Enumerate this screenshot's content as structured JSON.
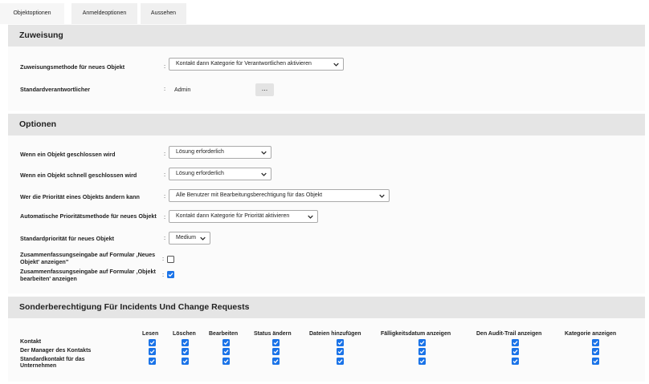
{
  "tabs": [
    {
      "label": "Objektoptionen",
      "active": true
    },
    {
      "label": "Anmeldeoptionen",
      "active": false
    },
    {
      "label": "Aussehen",
      "active": false
    }
  ],
  "sections": {
    "assignment": {
      "title": "Zuweisung",
      "method_label": "Zuweisungsmethode für neues Objekt",
      "method_value": "Kontakt dann Kategorie für Verantwortlichen aktivieren",
      "default_owner_label": "Standardverantwortlicher",
      "default_owner_value": "Admin",
      "browse_label": "..."
    },
    "options": {
      "title": "Optionen",
      "closed_label": "Wenn ein Objekt geschlossen wird",
      "closed_value": "Lösung erforderlich",
      "quick_closed_label": "Wenn ein Objekt schnell geschlossen wird",
      "quick_closed_value": "Lösung erforderlich",
      "priority_change_label": "Wer die Priorität eines Objekts ändern kann",
      "priority_change_value": "Alle Benutzer mit Bearbeitungsberechtigung für das Objekt",
      "auto_priority_label": "Automatische Prioritätsmethode für neues Objekt",
      "auto_priority_value": "Kontakt dann Kategorie für Priorität aktivieren",
      "default_priority_label": "Standardpriorität für neues Objekt",
      "default_priority_value": "Medium",
      "summary_new_label": "Zusammenfassungseingabe auf Formular ‚Neues Objekt' anzeigen\"",
      "summary_new_checked": false,
      "summary_edit_label": "Zusammenfassungseingabe auf Formular ‚Objekt bearbeiten' anzeigen",
      "summary_edit_checked": true
    },
    "permissions": {
      "title": "Sonderberechtigung Für Incidents Und Change Requests",
      "columns": [
        "Lesen",
        "Löschen",
        "Bearbeiten",
        "Status ändern",
        "Dateien hinzufügen",
        "Fälligkeitsdatum anzeigen",
        "Den Audit-Trail anzeigen",
        "Kategorie anzeigen"
      ],
      "rows": [
        {
          "label": "Kontakt",
          "checked": [
            true,
            true,
            true,
            true,
            true,
            true,
            true,
            true
          ]
        },
        {
          "label": "Der Manager des Kontakts",
          "checked": [
            true,
            true,
            true,
            true,
            true,
            true,
            true,
            true
          ]
        },
        {
          "label": "Standardkontakt für das Unternehmen",
          "checked": [
            true,
            true,
            true,
            true,
            true,
            true,
            true,
            true
          ]
        }
      ]
    }
  },
  "colors": {
    "accent": "#1a73e8",
    "header_bg": "#e5e5e5"
  }
}
